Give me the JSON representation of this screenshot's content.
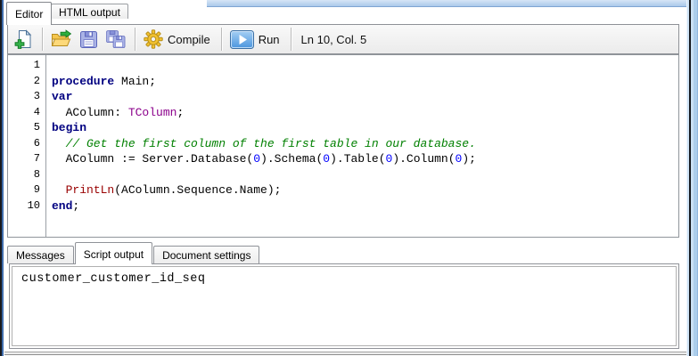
{
  "window": {
    "tabs_top": [
      {
        "label": "Editor",
        "active": true
      },
      {
        "label": "HTML output",
        "active": false
      }
    ],
    "toolbar": {
      "buttons": [
        {
          "name": "new-document",
          "icon": "new-document-icon"
        },
        {
          "name": "open",
          "icon": "open-folder-icon"
        },
        {
          "name": "save",
          "icon": "save-icon"
        },
        {
          "name": "save-all",
          "icon": "save-all-icon"
        },
        {
          "name": "compile",
          "icon": "gear-icon",
          "label": "Compile"
        },
        {
          "name": "run",
          "icon": "play-icon",
          "label": "Run"
        }
      ],
      "compile_label": "Compile",
      "run_label": "Run",
      "status": "Ln 10, Col. 5"
    }
  },
  "editor": {
    "syntax_colors": {
      "keyword": "#000080",
      "type": "#8b008b",
      "comment": "#008000",
      "number": "#0000ff",
      "function": "#990000",
      "plain": "#000000"
    },
    "lines": [
      {
        "no": "1",
        "segments": []
      },
      {
        "no": "2",
        "segments": [
          {
            "text": "procedure",
            "style": "keyword"
          },
          {
            "text": " Main;",
            "style": "plain"
          }
        ]
      },
      {
        "no": "3",
        "segments": [
          {
            "text": "var",
            "style": "keyword"
          }
        ]
      },
      {
        "no": "4",
        "segments": [
          {
            "text": "  AColumn: ",
            "style": "plain"
          },
          {
            "text": "TColumn",
            "style": "type"
          },
          {
            "text": ";",
            "style": "plain"
          }
        ]
      },
      {
        "no": "5",
        "segments": [
          {
            "text": "begin",
            "style": "keyword"
          }
        ]
      },
      {
        "no": "6",
        "segments": [
          {
            "text": "  // Get the first column of the first table in our database.",
            "style": "comment"
          }
        ]
      },
      {
        "no": "7",
        "segments": [
          {
            "text": "  AColumn := Server.Database(",
            "style": "plain"
          },
          {
            "text": "0",
            "style": "number"
          },
          {
            "text": ").Schema(",
            "style": "plain"
          },
          {
            "text": "0",
            "style": "number"
          },
          {
            "text": ").Table(",
            "style": "plain"
          },
          {
            "text": "0",
            "style": "number"
          },
          {
            "text": ").Column(",
            "style": "plain"
          },
          {
            "text": "0",
            "style": "number"
          },
          {
            "text": ");",
            "style": "plain"
          }
        ]
      },
      {
        "no": "8",
        "segments": []
      },
      {
        "no": "9",
        "segments": [
          {
            "text": "  ",
            "style": "plain"
          },
          {
            "text": "PrintLn",
            "style": "function"
          },
          {
            "text": "(AColumn.Sequence.Name);",
            "style": "plain"
          }
        ]
      },
      {
        "no": "10",
        "segments": [
          {
            "text": "end",
            "style": "keyword"
          },
          {
            "text": ";",
            "style": "plain"
          }
        ]
      }
    ]
  },
  "bottom": {
    "tabs": [
      {
        "label": "Messages",
        "active": false
      },
      {
        "label": "Script output",
        "active": true
      },
      {
        "label": "Document settings",
        "active": false
      }
    ],
    "output": "customer_customer_id_seq"
  },
  "accent_colors": {
    "run_button_blue": "#4a94dd",
    "compile_gear_gold": "#f2c12e",
    "frame_blue": "#abcdeb"
  }
}
